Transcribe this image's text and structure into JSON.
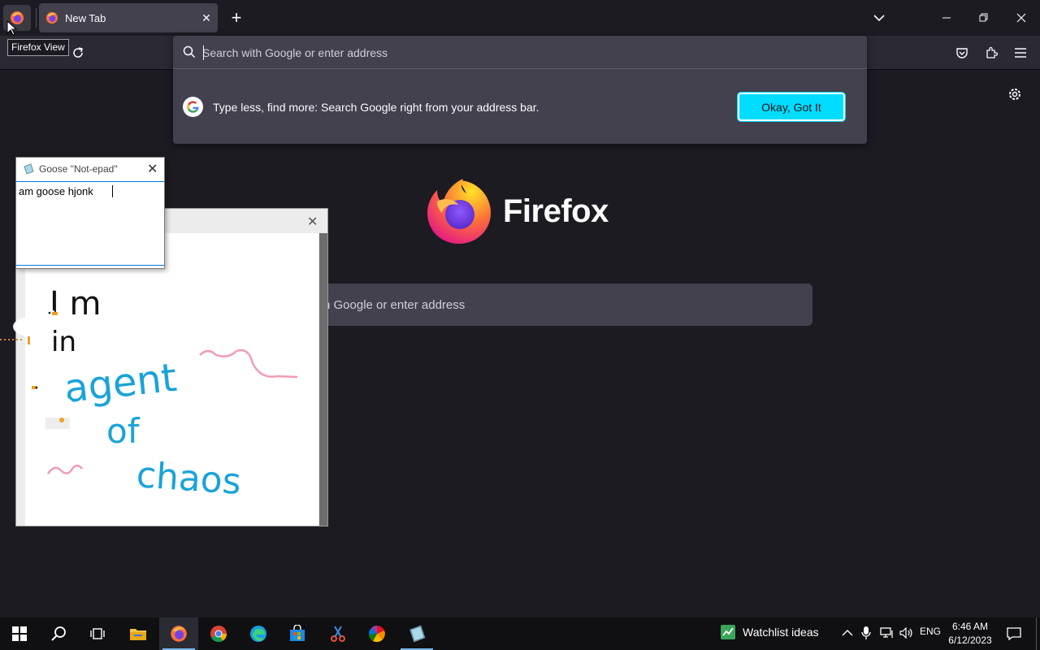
{
  "browser": {
    "tab_title": "New Tab",
    "tab_close": "✕",
    "new_tab_label": "+",
    "tooltip": "Firefox View"
  },
  "url_panel": {
    "placeholder": "Search with Google or enter address",
    "tip_text": "Type less, find more: Search Google right from your address bar.",
    "okay_button": "Okay, Got It"
  },
  "home": {
    "wordmark": "Firefox",
    "search_text": "h Google or enter address"
  },
  "notepad": {
    "title": "Goose \"Not-epad\"",
    "text": "am goose hjonk",
    "close": "✕"
  },
  "goose_image": {
    "close": "✕",
    "handwriting": [
      "I m",
      "in",
      "agent",
      "of",
      "chaos"
    ]
  },
  "taskbar": {
    "watchlist": "Watchlist ideas",
    "lang": "ENG",
    "time": "6:46 AM",
    "date": "6/12/2023"
  },
  "colors": {
    "accent": "#00ddff",
    "panel": "#42414d",
    "background": "#1c1b22",
    "handwriting_blue": "#1aa3d9",
    "scribble_pink": "#f29bb2"
  }
}
